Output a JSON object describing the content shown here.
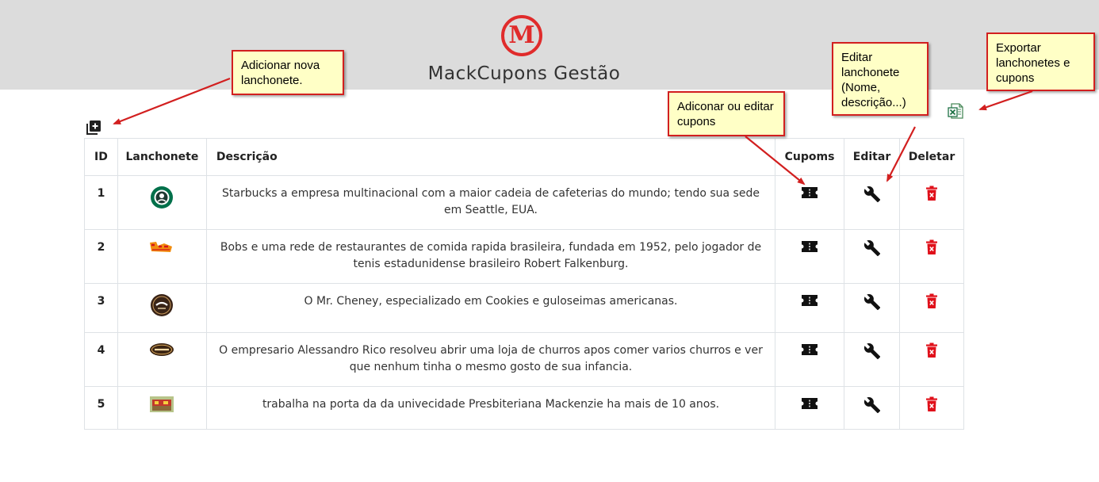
{
  "header": {
    "logo_letter": "M",
    "title": "MackCupons Gestão"
  },
  "table": {
    "columns": [
      "ID",
      "Lanchonete",
      "Descrição",
      "Cupoms",
      "Editar",
      "Deletar"
    ],
    "rows": [
      {
        "id": "1",
        "logo": "starbucks-logo",
        "description": "Starbucks a empresa multinacional com a maior cadeia de cafeterias do mundo; tendo sua sede em Seattle, EUA."
      },
      {
        "id": "2",
        "logo": "bobs-logo",
        "description": "Bobs e uma rede de restaurantes de comida rapida brasileira, fundada em 1952, pelo jogador de tenis estadunidense brasileiro Robert Falkenburg."
      },
      {
        "id": "3",
        "logo": "mr-cheney-logo",
        "description": "O Mr. Cheney, especializado em Cookies e guloseimas americanas."
      },
      {
        "id": "4",
        "logo": "churros-logo",
        "description": "O empresario Alessandro Rico resolveu abrir uma loja de churros apos comer varios churros e ver que nenhum tinha o mesmo gosto de sua infancia."
      },
      {
        "id": "5",
        "logo": "food-stand-photo",
        "description": "trabalha na porta da da univecidade Presbiteriana Mackenzie ha mais de 10 anos."
      }
    ]
  },
  "annotations": {
    "add": "Adicionar nova lanchonete.",
    "coupons": "Adiconar ou editar cupons",
    "edit": "Editar lanchonete (Nome, descrição...)",
    "export": "Exportar lanchonetes e cupons"
  },
  "colors": {
    "header_bg": "#dcdcdc",
    "brand_red": "#e02b2b",
    "delete_red": "#e0101a",
    "note_bg": "#ffffc6",
    "note_border": "#d21f1f"
  },
  "icons": {
    "add": "add-box-icon",
    "export": "excel-export-icon",
    "coupon": "ticket-icon",
    "edit": "wrench-icon",
    "delete": "trash-icon"
  }
}
